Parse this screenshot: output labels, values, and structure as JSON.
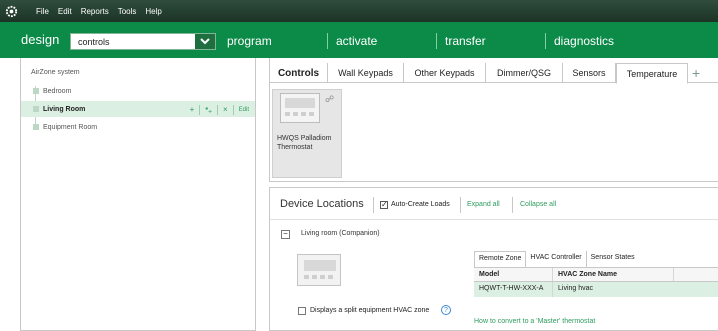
{
  "menubar": {
    "items": [
      "File",
      "Edit",
      "Reports",
      "Tools",
      "Help"
    ]
  },
  "nav": {
    "mode": "design",
    "selector_value": "controls",
    "tabs": [
      "program",
      "activate",
      "transfer",
      "diagnostics"
    ]
  },
  "tree": {
    "root": "AirZone system",
    "items": [
      {
        "label": "Bedroom",
        "selected": false
      },
      {
        "label": "Living Room",
        "selected": true
      },
      {
        "label": "Equipment Room",
        "selected": false
      }
    ],
    "actions": {
      "add": "+",
      "add_sub": "+",
      "delete": "×",
      "edit": "Edit"
    }
  },
  "controls": {
    "title": "Controls",
    "tabs": [
      "Wall Keypads",
      "Other Keypads",
      "Dimmer/QSG",
      "Sensors",
      "Temperature"
    ],
    "active_tab": "Temperature",
    "add_tab": "+",
    "device": {
      "label": "HWQS Palladiom Thermostat"
    }
  },
  "device_locations": {
    "title": "Device Locations",
    "auto_create_label": "Auto-Create Loads",
    "auto_create_checked": true,
    "expand_all": "Expand all",
    "collapse_all": "Collapse all",
    "location_label": "Living room  (Companion)",
    "toggle": "−",
    "split_label": "Displays a split equipment HVAC zone",
    "help": "?",
    "subtabs": [
      "Remote Zone",
      "HVAC Controller",
      "Sensor States"
    ],
    "columns": [
      "Model",
      "HVAC Zone Name"
    ],
    "rows": [
      {
        "model": "HQWT-T-HW-XXX-A",
        "zone": "Living hvac"
      }
    ],
    "convert_link": "How to convert to a 'Master' thermostat"
  },
  "colors": {
    "brand_green": "#0b8a48",
    "menubar_dark": "#1b3325",
    "link_green": "#2e9c5e",
    "selected_row": "#dcefe3"
  }
}
